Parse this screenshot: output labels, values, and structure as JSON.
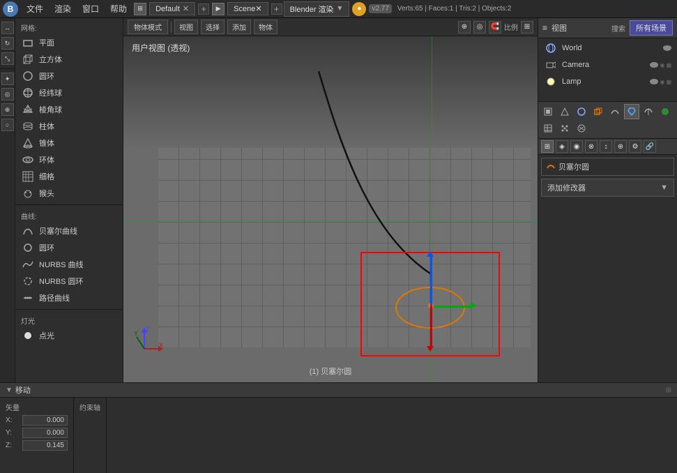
{
  "topbar": {
    "icon": "B",
    "menus": [
      "文件",
      "渲染",
      "窗口",
      "帮助"
    ],
    "workspace_label": "Default",
    "scene_label": "Scene",
    "render_engine": "Blender 渲染",
    "version": "v2.77",
    "stats": "Verts:65 | Faces:1 | Tris:2 | Objects:2"
  },
  "viewport": {
    "header": "用户视图 (透视)",
    "bottom_label": "(1) 贝塞尔圆"
  },
  "outliner": {
    "header": "视图",
    "search_btn": "搜索",
    "all_scenes_btn": "所有场景",
    "items": [
      {
        "label": "World",
        "icon": "world"
      },
      {
        "label": "Camera",
        "icon": "camera"
      },
      {
        "label": "Lamp",
        "icon": "lamp"
      }
    ]
  },
  "properties": {
    "object_icon": "○",
    "object_name": "贝塞尔圆",
    "modifier_btn_label": "添加修改器",
    "tabs": [
      "render",
      "scene",
      "world",
      "object",
      "constraints",
      "modifiers",
      "data",
      "material",
      "texture",
      "particles",
      "physics"
    ]
  },
  "bottom": {
    "section_title": "移动",
    "vector_label": "矢量",
    "x_label": "X:",
    "x_value": "0.000",
    "y_label": "Y:",
    "y_value": "0.000",
    "z_label": "Z:",
    "z_value": "0.145",
    "constraint_label": "约束轴"
  },
  "left_sidebar": {
    "mesh_section": "网格:",
    "mesh_items": [
      "平面",
      "立方体",
      "圆环",
      "经纬球",
      "棱角球",
      "柱体",
      "锥体",
      "环体"
    ],
    "grid_label": "细格",
    "monkey_label": "猴头",
    "curve_section": "曲线:",
    "curve_items": [
      "贝塞尔曲线",
      "圆环",
      "NURBS 曲线",
      "NURBS 圆环",
      "路径曲线"
    ],
    "lamp_section": "灯光",
    "lamp_items": [
      "点光"
    ]
  }
}
